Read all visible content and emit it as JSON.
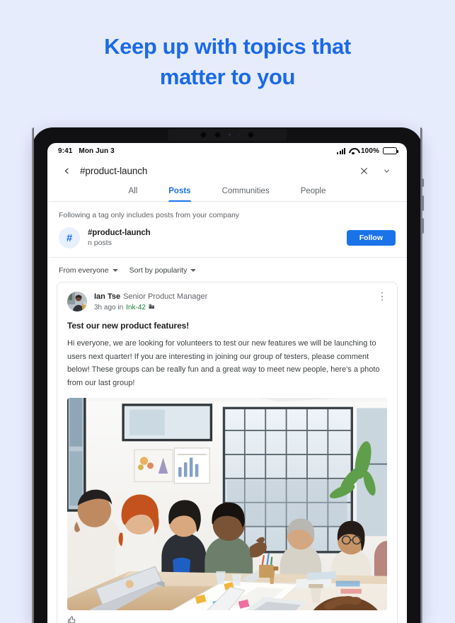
{
  "headline": {
    "line1": "Keep up with topics that",
    "line2": "matter to you",
    "color": "#1b6ae8"
  },
  "background_color": "#e7ecfd",
  "status_bar": {
    "time": "9:41",
    "date": "Mon Jun 3",
    "battery_percent": "100%",
    "signal_icon": "cellular-signal-icon",
    "wifi_icon": "wifi-icon",
    "battery_icon": "battery-icon"
  },
  "app_header": {
    "back_icon": "back-chevron-icon",
    "title": "#product-launch",
    "close_icon": "close-x-icon",
    "overflow_icon": "chevron-down-icon"
  },
  "tabs": [
    {
      "label": "All",
      "active": false
    },
    {
      "label": "Posts",
      "active": true
    },
    {
      "label": "Communities",
      "active": false
    },
    {
      "label": "People",
      "active": false
    }
  ],
  "notice": "Following a tag only includes posts from your company",
  "tag": {
    "avatar_icon": "hashtag-icon",
    "avatar_glyph": "#",
    "name": "#product-launch",
    "count": "n posts",
    "follow_label": "Follow",
    "follow_color": "#1a73e8"
  },
  "filters": [
    {
      "label": "From everyone",
      "icon": "chevron-down-icon"
    },
    {
      "label": "Sort by popularity",
      "icon": "chevron-down-icon"
    }
  ],
  "post": {
    "avatar_icon": "user-avatar-photo",
    "author": "Ian Tse",
    "role": "Senior Product Manager",
    "timestamp": "3h ago in",
    "org": "Ink-42",
    "org_color": "#188038",
    "org_icon": "company-building-icon",
    "overflow_icon": "kebab-menu-icon",
    "title": "Test our new product features!",
    "body": "Hi everyone, we are looking for volunteers to test our new features we will be launching to users next quarter! If you are interesting in joining our group of testers, please comment below! These groups can be really fun and a great way to meet new people, here's a photo from our last group!",
    "image_alt": "Office meeting photo with colleagues around a conference table",
    "like_icon": "thumbs-up-icon"
  }
}
